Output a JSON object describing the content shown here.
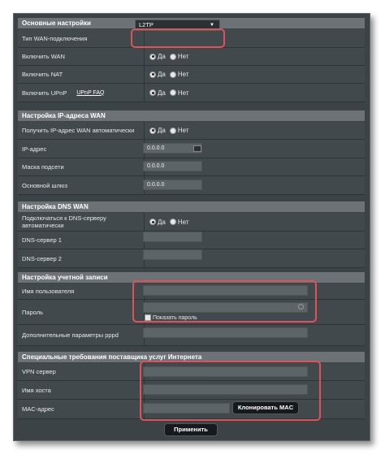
{
  "sections": {
    "basic": "Основные настройки",
    "ip": "Настройка IP-адреса WAN",
    "dns": "Настройка DNS WAN",
    "account": "Настройка учетной записи",
    "isp": "Специальные требования поставщика услуг Интернета"
  },
  "basic": {
    "wan_type_label": "Тип WAN-подключения",
    "wan_type_value": "L2TP",
    "enable_wan_label": "Включить WAN",
    "enable_nat_label": "Включить NAT",
    "enable_upnp_label": "Включить UPnP",
    "upnp_faq": "UPnP  FAQ"
  },
  "radio": {
    "yes": "Да",
    "no": "Нет"
  },
  "ip": {
    "auto_label": "Получить IP-адрес WAN автоматически",
    "ip_label": "IP-адрес",
    "ip_value": "0.0.0.0",
    "mask_label": "Маска подсети",
    "mask_value": "0.0.0.0",
    "gateway_label": "Основной шлюз",
    "gateway_value": "0.0.0.0"
  },
  "dns": {
    "auto_label": "Подключаться к DNS-серверу автоматически",
    "dns1_label": "DNS-сервер 1",
    "dns2_label": "DNS-сервер 2"
  },
  "account": {
    "user_label": "Имя пользователя",
    "password_label": "Пароль",
    "show_password": "Показать пароль",
    "pppd_label": "Дополнительные параметры pppd"
  },
  "isp": {
    "vpn_label": "VPN сервер",
    "host_label": "Имя хоста",
    "mac_label": "MAC-адрес",
    "clone_mac": "Клонировать MAC"
  },
  "apply": "Применить",
  "colors": {
    "highlight": "#e0525a",
    "panel": "#3b4347",
    "section": "#6c7275"
  }
}
